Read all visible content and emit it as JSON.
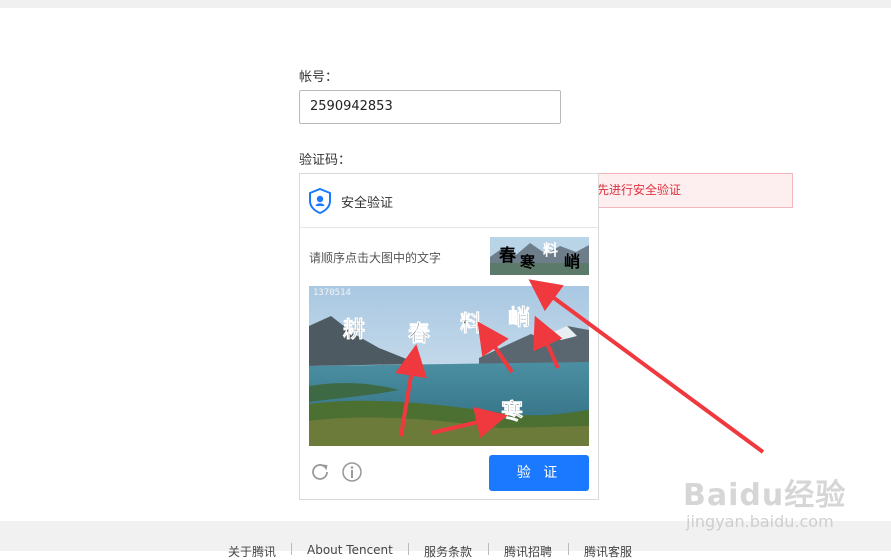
{
  "form": {
    "account_label": "帐号：",
    "account_value": "2590942853",
    "captcha_label": "验证码：",
    "error_text": "先进行安全验证"
  },
  "captcha": {
    "title": "安全验证",
    "instruction": "请顺序点击大图中的文字",
    "image_id": "1370514",
    "sequence": [
      "春",
      "寒",
      "料",
      "峭"
    ],
    "image_chars": [
      "耕",
      "春",
      "料",
      "峭",
      "寒"
    ],
    "verify_label": "验 证",
    "refresh_icon": "refresh-icon",
    "info_icon": "info-icon",
    "accent_color": "#1a79ff"
  },
  "footer": {
    "links": [
      "关于腾讯",
      "About Tencent",
      "服务条款",
      "腾讯招聘",
      "腾讯客服"
    ]
  },
  "watermark": {
    "main": "Baidu经验",
    "sub": "jingyan.baidu.com"
  }
}
